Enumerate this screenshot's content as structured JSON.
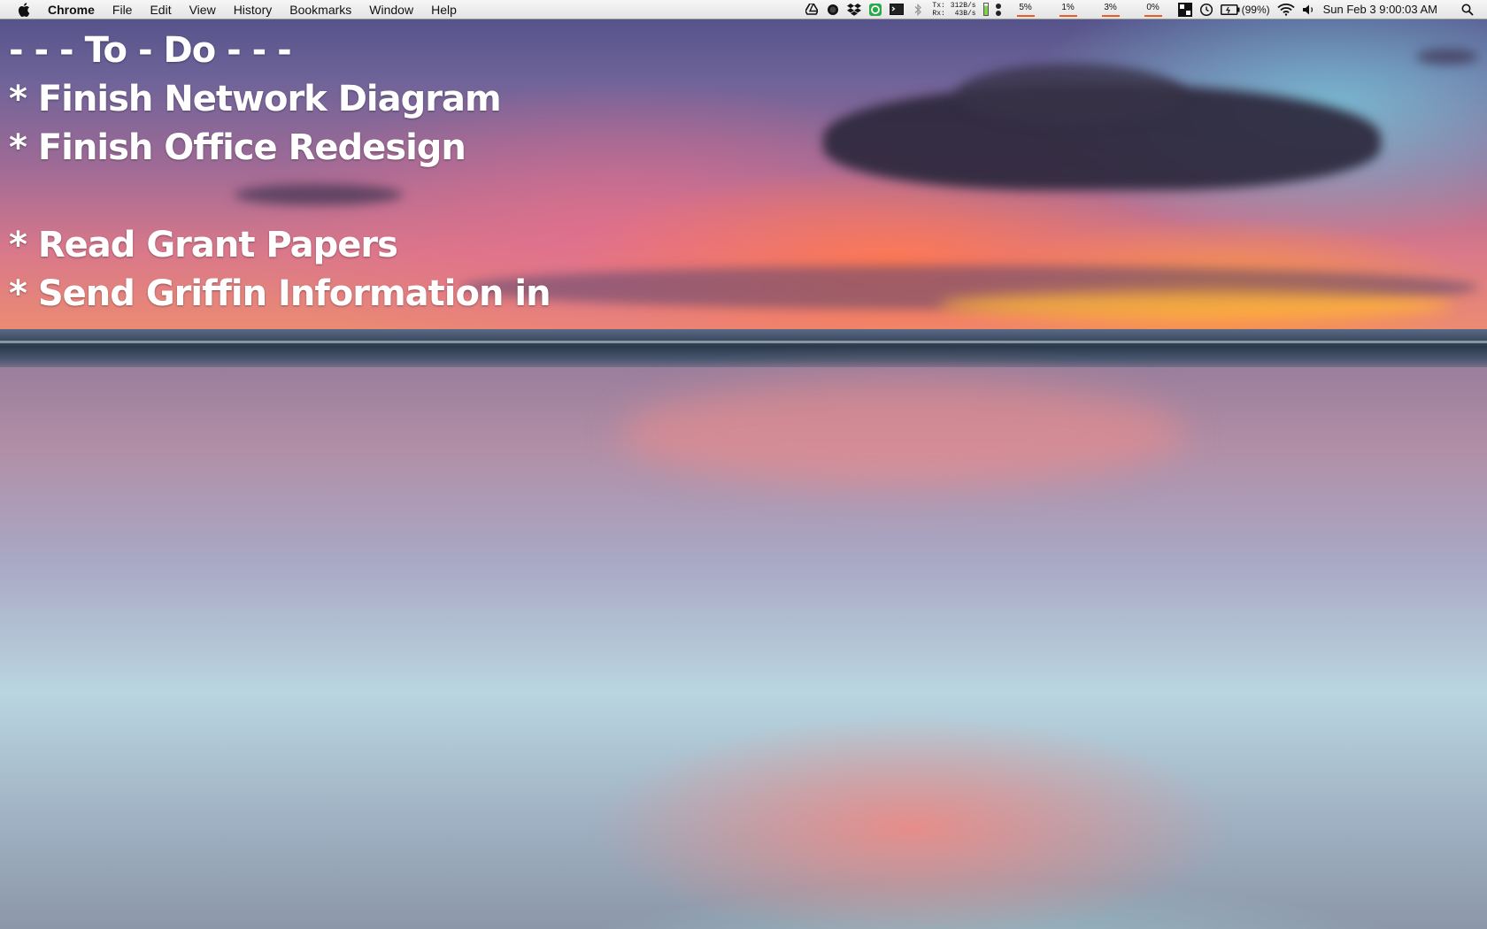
{
  "menubar": {
    "app_name": "Chrome",
    "menus": [
      "File",
      "Edit",
      "View",
      "History",
      "Bookmarks",
      "Window",
      "Help"
    ],
    "status": {
      "net_tx_label": "Tx:",
      "net_rx_label": "Rx:",
      "net_tx_value": "312B/s",
      "net_rx_value": "43B/s",
      "cpu_core1": "5%",
      "cpu_core2": "1%",
      "cpu_core3": "3%",
      "cpu_core4": "0%",
      "battery": "(99%)",
      "clock": "Sun Feb 3  9:00:03 AM"
    }
  },
  "todo": {
    "title": "- - - To - Do - - -",
    "items": [
      "* Finish Network Diagram",
      "* Finish Office Redesign",
      "",
      "* Read Grant Papers",
      "* Send Griffin Information in"
    ]
  },
  "wallpaper": {
    "description_colors": {
      "sky_top": "#4f4e86",
      "sunset": "#f0906c",
      "reflection": "#b9d6e0"
    }
  }
}
